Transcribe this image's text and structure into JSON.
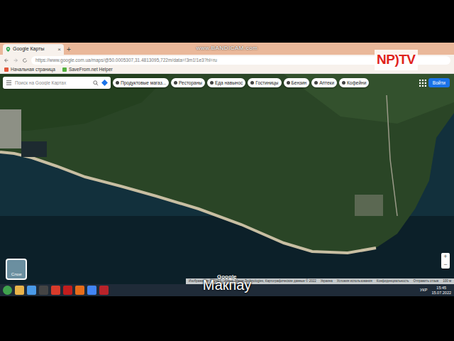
{
  "watermark": "www.BANDICAM.com",
  "channel_logo": "NP)TV",
  "browser": {
    "tabs": [
      {
        "label": "Google Карты",
        "selected": true
      }
    ],
    "tab_close": "×",
    "new_tab": "+",
    "url": "https://www.google.com.ua/maps/@50.0005307,31.4813095,722m/data=!3m1!1e3?hl=ru",
    "bookmarks": [
      "Начальная страница",
      "SaveFrom.net Helper"
    ]
  },
  "maps": {
    "search": {
      "placeholder": "Поиск на Google Картах"
    },
    "chips": [
      "Продуктовые магаз...",
      "Рестораны",
      "Еда навынос",
      "Гостиницы",
      "Бензин",
      "Аптеки",
      "Кофейни"
    ],
    "sign_in": "Войти",
    "layers": "Слои",
    "logo": "Google",
    "zoom": [
      "+",
      "−"
    ],
    "footer": [
      "Изображения © CNES / Airbus, Maxar Technologies, Картографические данные © 2022",
      "Украина",
      "Условия использования",
      "Конфиденциальность",
      "Отправить отзыв",
      "100 м"
    ]
  },
  "subtitle": "Макпау",
  "taskbar": {
    "language": "УКР",
    "time": "15:45",
    "date": "15.07.2022"
  }
}
